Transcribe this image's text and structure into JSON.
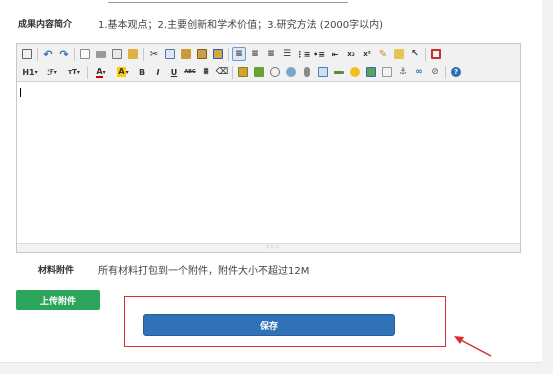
{
  "form": {
    "summary_label": "成果内容简介",
    "summary_hint": "1.基本观点；2.主要创新和学术价值；3.研究方法 (2000字以内)",
    "attachment_label": "材料附件",
    "attachment_hint": "所有材料打包到一个附件，附件大小不超过12M",
    "upload_button": "上传附件",
    "save_button": "保存"
  },
  "editor": {
    "content": "",
    "toolbar_row1": [
      "source-icon",
      "undo-icon",
      "redo-icon",
      "new-page-icon",
      "print-icon",
      "preview-icon",
      "template-icon",
      "cut-icon",
      "copy-icon",
      "paste-icon",
      "paste-text-icon",
      "paste-word-icon",
      "align-left-icon",
      "align-center-icon",
      "align-right-icon",
      "align-justify-icon",
      "ordered-list-icon",
      "unordered-list-icon",
      "outdent-icon",
      "subscript-icon",
      "superscript-icon",
      "clear-format-icon",
      "select-all-icon",
      "cursor-icon",
      "fullscreen-icon"
    ],
    "toolbar_row2": [
      "heading-icon",
      "font-family-icon",
      "font-size-icon",
      "font-color-icon",
      "highlight-icon",
      "bold-icon",
      "italic-icon",
      "underline-icon",
      "strikethrough-icon",
      "line-height-icon",
      "remove-format-icon",
      "image-icon",
      "multi-image-icon",
      "flash-icon",
      "media-icon",
      "insert-file-icon",
      "table-icon",
      "horizontal-rule-icon",
      "emoticon-icon",
      "map-icon",
      "code-icon",
      "anchor-icon",
      "link-icon",
      "unlink-icon",
      "about-icon"
    ],
    "labels": {
      "heading": "H1",
      "font_family": "ℱ",
      "font_size": "ᴛT",
      "font_color": "A",
      "highlight": "A",
      "bold": "B",
      "italic": "I",
      "underline": "U",
      "strikethrough": "ABC",
      "subscript": "x₂",
      "superscript": "x²"
    },
    "colors": {
      "font_color_bar": "#d00000",
      "highlight_bar": "#ffcc00",
      "active_border": "#6a9ad0"
    }
  },
  "colors": {
    "upload_button": "#2aa55a",
    "save_button": "#2f72b8",
    "annotation": "#d83030"
  }
}
